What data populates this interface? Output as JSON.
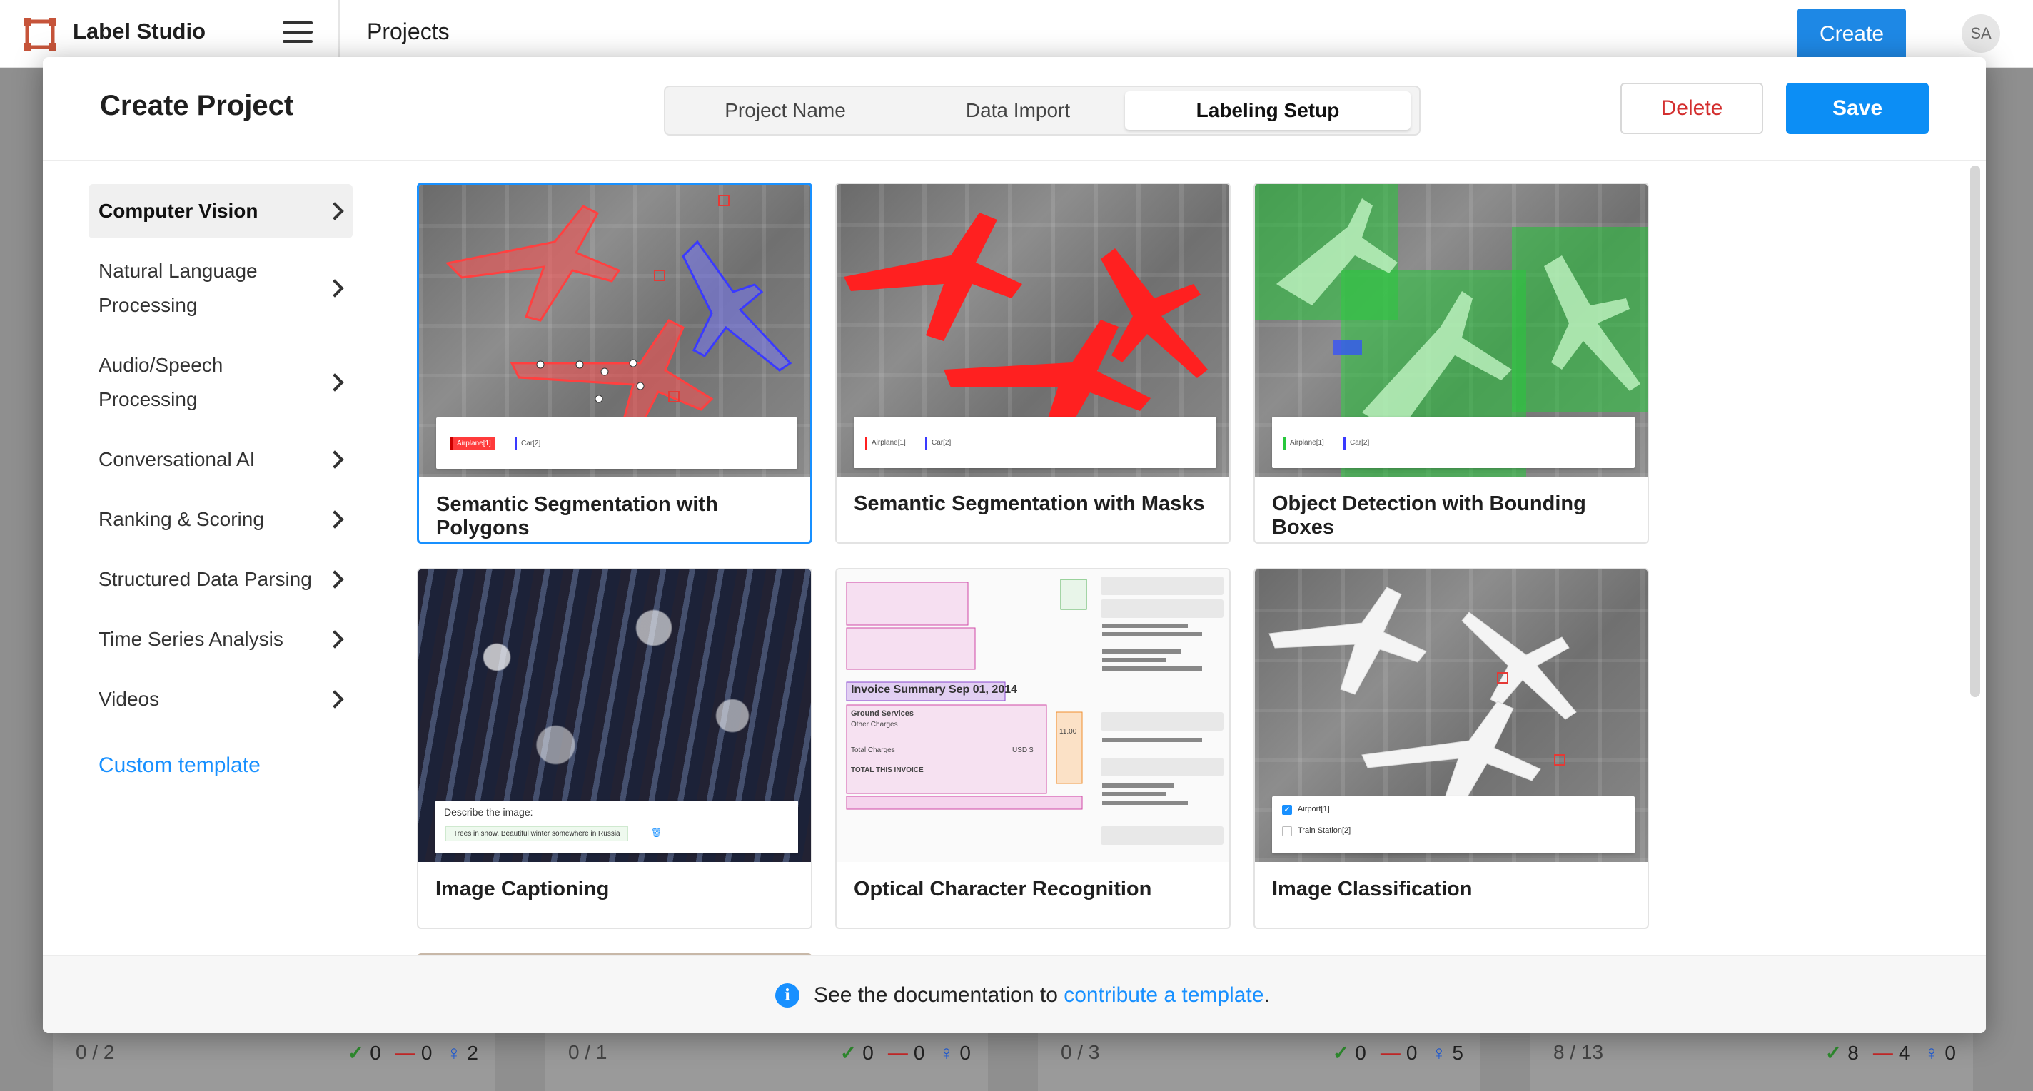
{
  "app": {
    "name": "Label Studio",
    "page_title": "Projects",
    "create_label": "Create",
    "avatar_initials": "SA",
    "brand_color": "#c6543a"
  },
  "background_cards": [
    {
      "count": "0 / 2",
      "completed": "0",
      "skipped": "0",
      "predictions": "2"
    },
    {
      "count": "0 / 1",
      "completed": "0",
      "skipped": "0",
      "predictions": "0"
    },
    {
      "count": "0 / 3",
      "completed": "0",
      "skipped": "0",
      "predictions": "5"
    },
    {
      "count": "8 / 13",
      "completed": "8",
      "skipped": "4",
      "predictions": "0"
    }
  ],
  "modal": {
    "title": "Create Project",
    "tabs": [
      {
        "label": "Project Name",
        "active": false
      },
      {
        "label": "Data Import",
        "active": false
      },
      {
        "label": "Labeling Setup",
        "active": true
      }
    ],
    "delete_label": "Delete",
    "save_label": "Save",
    "accent_color": "#1890ff",
    "danger_color": "#d32f2f"
  },
  "sidebar": {
    "items": [
      {
        "label": "Computer Vision",
        "active": true
      },
      {
        "label": "Natural Language Processing",
        "active": false
      },
      {
        "label": "Audio/Speech Processing",
        "active": false
      },
      {
        "label": "Conversational AI",
        "active": false
      },
      {
        "label": "Ranking & Scoring",
        "active": false
      },
      {
        "label": "Structured Data Parsing",
        "active": false
      },
      {
        "label": "Time Series Analysis",
        "active": false
      },
      {
        "label": "Videos",
        "active": false
      }
    ],
    "custom_template": "Custom template"
  },
  "templates": [
    {
      "label": "Semantic Segmentation with Polygons",
      "selected": true,
      "chips": [
        "Airplane[1]",
        "Car[2]"
      ]
    },
    {
      "label": "Semantic Segmentation with Masks",
      "selected": false,
      "chips": [
        "Airplane[1]",
        "Car[2]"
      ]
    },
    {
      "label": "Object Detection with Bounding Boxes",
      "selected": false,
      "chips": [
        "Airplane[1]",
        "Car[2]"
      ]
    },
    {
      "label": "Image Captioning",
      "selected": false,
      "prompt": "Describe the image:",
      "caption": "Trees in snow. Beautiful winter somewhere in Russia"
    },
    {
      "label": "Optical Character Recognition",
      "selected": false,
      "ocr_lines": [
        "Invoice Summary Sep 01, 2014",
        "Ground Services",
        "Other Charges",
        "Total Charges",
        "TOTAL THIS INVOICE",
        "USD $",
        "11.00"
      ]
    },
    {
      "label": "Image Classification",
      "selected": false,
      "choices": [
        "Airport[1]",
        "Train Station[2]"
      ]
    }
  ],
  "footer": {
    "text_before": "See the documentation to ",
    "link_text": "contribute a template",
    "text_after": "."
  }
}
